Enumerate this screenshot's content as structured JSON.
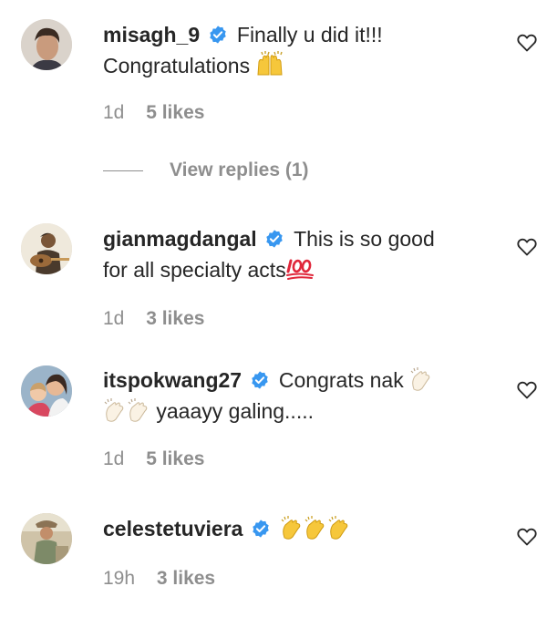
{
  "comments": [
    {
      "username": "misagh_9",
      "text_line1": "Finally u did it!!!",
      "text_line2": "Congratulations",
      "emoji": "raising-hands",
      "time": "1d",
      "likes": "5 likes"
    },
    {
      "username": "gianmagdangal",
      "text_line1": "This is so good",
      "text_line2": "for all specialty acts",
      "emoji": "hundred-points",
      "time": "1d",
      "likes": "3 likes"
    },
    {
      "username": "itspokwang27",
      "text_line1": "Congrats nak",
      "text_line2": "yaaayy galing.....",
      "emoji": "clapping-hands",
      "time": "1d",
      "likes": "5 likes"
    },
    {
      "username": "celestetuviera",
      "emoji": "clapping-hands",
      "time": "19h",
      "likes": "3 likes"
    }
  ],
  "view_replies": "View replies (1)",
  "colors": {
    "text": "#262626",
    "muted": "#8e8e8e",
    "verified": "#3897f0"
  }
}
